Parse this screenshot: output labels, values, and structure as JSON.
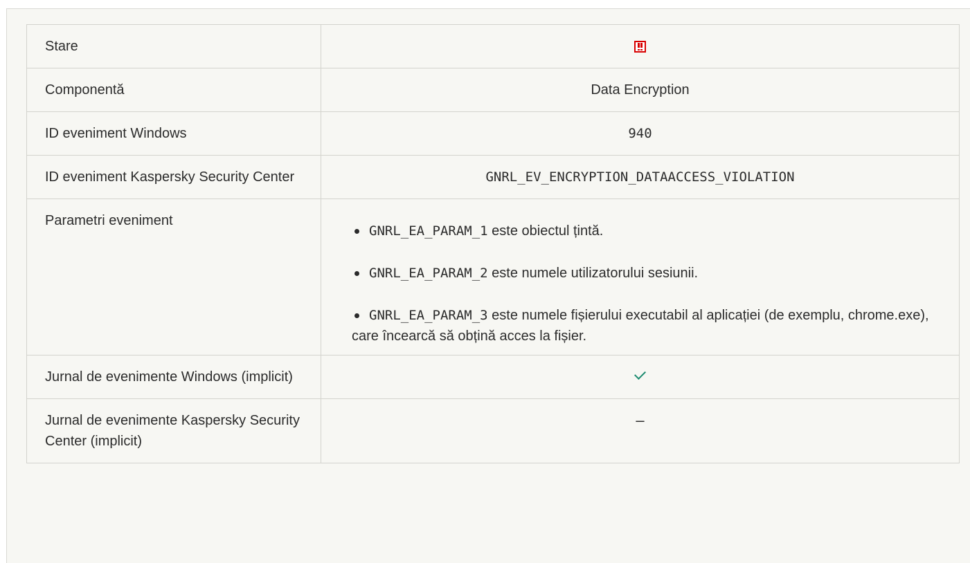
{
  "table": {
    "rows": [
      {
        "label": "Stare",
        "value_type": "status-icon",
        "icon": "error-status-icon",
        "icon_color": "#d80000"
      },
      {
        "label": "Componentă",
        "value": "Data Encryption"
      },
      {
        "label": "ID eveniment Windows",
        "value": "940"
      },
      {
        "label": "ID eveniment Kaspersky Security Center",
        "value": "GNRL_EV_ENCRYPTION_DATAACCESS_VIOLATION"
      },
      {
        "label": "Parametri eveniment",
        "params": [
          {
            "code": "GNRL_EA_PARAM_1",
            "text": " este obiectul țintă."
          },
          {
            "code": "GNRL_EA_PARAM_2",
            "text": " este numele utilizatorului sesiunii."
          },
          {
            "code": "GNRL_EA_PARAM_3",
            "text": " este numele fișierului executabil al aplicației (de exemplu, chrome.exe), care încearcă să obțină acces la fișier."
          }
        ]
      },
      {
        "label": "Jurnal de evenimente Windows (implicit)",
        "value_type": "check-icon",
        "icon": "check-icon",
        "icon_color": "#1a8a6e"
      },
      {
        "label": "Jurnal de evenimente Kaspersky Security Center (implicit)",
        "value": "–"
      }
    ]
  }
}
